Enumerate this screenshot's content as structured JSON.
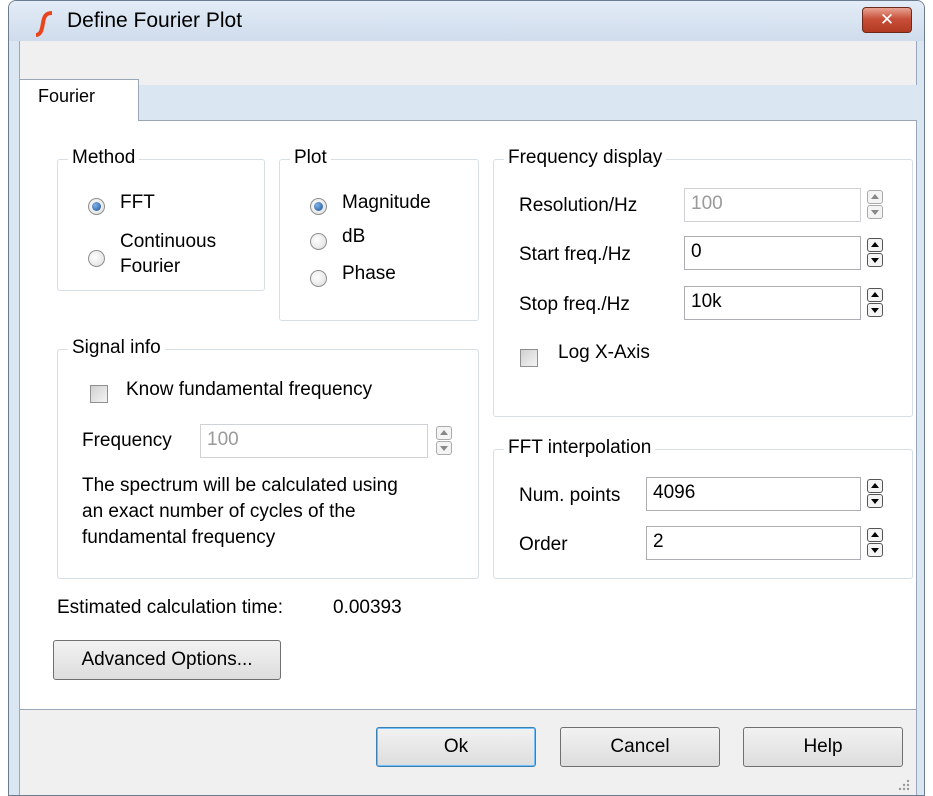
{
  "window": {
    "title": "Define Fourier Plot",
    "close_label": "✕"
  },
  "tabs": [
    {
      "label": "Fourier"
    }
  ],
  "method": {
    "legend": "Method",
    "options": [
      {
        "label": "FFT",
        "selected": true
      },
      {
        "label_line1": "Continuous",
        "label_line2": "Fourier",
        "selected": false
      }
    ]
  },
  "plot": {
    "legend": "Plot",
    "options": [
      {
        "label": "Magnitude",
        "selected": true
      },
      {
        "label": "dB",
        "selected": false
      },
      {
        "label": "Phase",
        "selected": false
      }
    ]
  },
  "frequency_display": {
    "legend": "Frequency display",
    "resolution": {
      "label": "Resolution/Hz",
      "value": "100"
    },
    "start_freq": {
      "label": "Start freq./Hz",
      "value": "0"
    },
    "stop_freq": {
      "label": "Stop freq./Hz",
      "value": "10k"
    },
    "log_x_axis": {
      "label": "Log X-Axis",
      "checked": false
    }
  },
  "signal_info": {
    "legend": "Signal info",
    "know_fundamental": {
      "label": "Know fundamental frequency",
      "checked": false
    },
    "frequency": {
      "label": "Frequency",
      "value": "100"
    },
    "note_line1": "The spectrum will be calculated using",
    "note_line2": "an exact number of cycles of the",
    "note_line3": "fundamental frequency"
  },
  "fft_interpolation": {
    "legend": "FFT interpolation",
    "num_points": {
      "label": "Num. points",
      "value": "4096"
    },
    "order": {
      "label": "Order",
      "value": "2"
    }
  },
  "estimated": {
    "label": "Estimated calculation time:",
    "value": "0.00393"
  },
  "buttons": {
    "advanced": "Advanced Options...",
    "ok": "Ok",
    "cancel": "Cancel",
    "help": "Help"
  }
}
